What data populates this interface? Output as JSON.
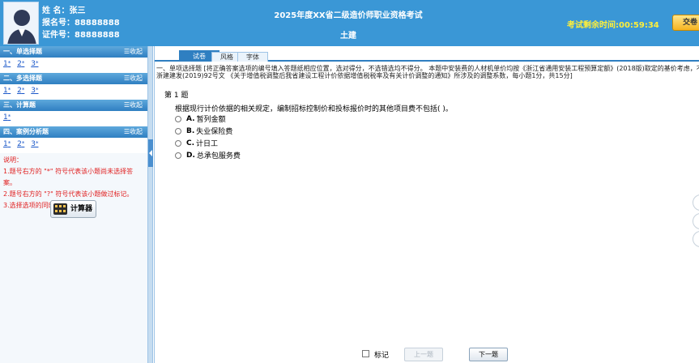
{
  "candidate": {
    "name_label": "姓  名：",
    "name": "张三",
    "reg_label": "报名号：",
    "reg_no": "88888888",
    "cert_label": "证件号：",
    "cert_no": "88888888"
  },
  "exam": {
    "title": "2025年度XX省二级造价师职业资格考试",
    "subject": "土建",
    "timer_label": "考试剩余时间:",
    "timer_value": "00:59:34",
    "submit_label": "交卷"
  },
  "sidebar": {
    "collapse_label": "☰收起",
    "sections": [
      {
        "title": "一、单选择题",
        "questions": [
          {
            "num": "1",
            "mark": "*"
          },
          {
            "num": "2",
            "mark": "*"
          },
          {
            "num": "3",
            "mark": "*"
          }
        ]
      },
      {
        "title": "二、多选择题",
        "questions": [
          {
            "num": "1",
            "mark": "*"
          },
          {
            "num": "2",
            "mark": "*"
          },
          {
            "num": "3",
            "mark": "*"
          }
        ]
      },
      {
        "title": "三、计算题",
        "questions": [
          {
            "num": "1",
            "mark": "*"
          }
        ]
      },
      {
        "title": "四、案例分析题",
        "questions": [
          {
            "num": "1",
            "mark": "*"
          },
          {
            "num": "2",
            "mark": "*"
          },
          {
            "num": "3",
            "mark": "*"
          }
        ]
      }
    ],
    "notes_title": "说明：",
    "notes": [
      "1.题号右方的 \"*\" 符号代表该小题尚未选择答案。",
      "2.题号右方的 \"?\" 符号代表该小题做过标记。",
      "3.选择选项的同时自动保存答案。"
    ],
    "calculator_label": "计算器"
  },
  "tabs": [
    {
      "label": "试卷",
      "active": true
    },
    {
      "label": "风格",
      "active": false
    },
    {
      "label": "字体",
      "active": false
    }
  ],
  "question": {
    "instruction_line1": "一、单项选择题 [将正确答案选项的编号填入答题纸相应位置，选对得分，不选错选均不得分。 本题中安装费的人材机单价均按《浙江省通用安装工程预算定额》(2018版)取定的基价考虑，不考虑",
    "instruction_line2": "浙建建发(2019)92号文 《关于增值税调整后我省建设工程计价依据增值税税率及有关计价调整的通知》所涉及的调整系数，每小题1分，共15分]",
    "number_label": "第 1 题",
    "stem": "根据现行计价依据的相关规定，编制招标控制价和投标报价时的其他项目费不包括(    )。",
    "options": [
      {
        "key": "A.",
        "text": "暂列金额"
      },
      {
        "key": "B.",
        "text": "失业保险费"
      },
      {
        "key": "C.",
        "text": "计日工"
      },
      {
        "key": "D.",
        "text": "总承包服务费"
      }
    ]
  },
  "footer": {
    "flag_label": "标记",
    "prev_label": "上一题",
    "next_label": "下一题"
  }
}
